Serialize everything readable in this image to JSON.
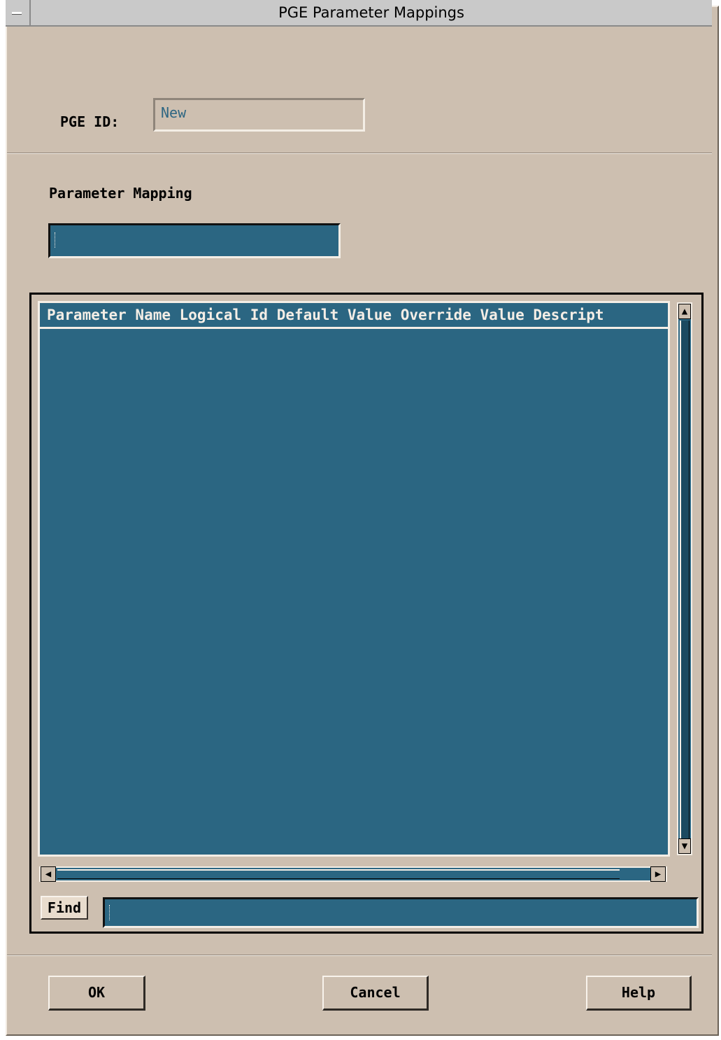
{
  "window": {
    "title": "PGE Parameter Mappings"
  },
  "pge_id": {
    "label": "PGE ID:",
    "value": "New"
  },
  "parameter_mapping": {
    "label": "Parameter Mapping",
    "value": ""
  },
  "list": {
    "header": "Parameter Name Logical Id Default Value Override Value Descript",
    "rows": []
  },
  "find": {
    "button_label": "Find",
    "value": ""
  },
  "buttons": {
    "ok": "OK",
    "cancel": "Cancel",
    "help": "Help"
  },
  "colors": {
    "background": "#cdbfb0",
    "list_background": "#2b6682",
    "title_bar": "#c9c9c9"
  }
}
